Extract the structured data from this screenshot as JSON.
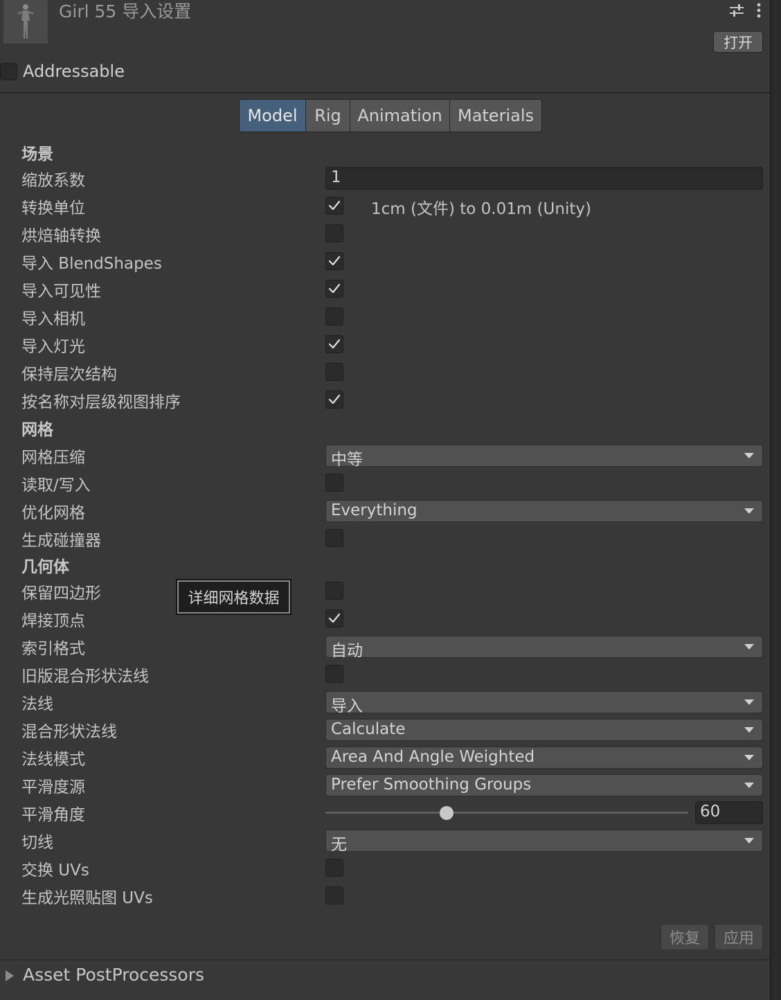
{
  "header": {
    "title": "Girl 55 导入设置",
    "thumbnail_icon": "character-model-icon",
    "open_button": "打开",
    "addressable_label": "Addressable",
    "addressable_checked": false
  },
  "tabs": [
    {
      "label": "Model",
      "active": true
    },
    {
      "label": "Rig",
      "active": false
    },
    {
      "label": "Animation",
      "active": false
    },
    {
      "label": "Materials",
      "active": false
    }
  ],
  "sections": {
    "scene": "场景",
    "meshes": "网格",
    "geometry": "几何体"
  },
  "rows": [
    {
      "label": "缩放系数",
      "type": "text",
      "value": "1"
    },
    {
      "label": "转换单位",
      "type": "checkbox",
      "checked": true,
      "note": "1cm (文件) to 0.01m (Unity)"
    },
    {
      "label": "烘焙轴转换",
      "type": "checkbox",
      "checked": false
    },
    {
      "label": "导入 BlendShapes",
      "type": "checkbox",
      "checked": true
    },
    {
      "label": "导入可见性",
      "type": "checkbox",
      "checked": true
    },
    {
      "label": "导入相机",
      "type": "checkbox",
      "checked": false
    },
    {
      "label": "导入灯光",
      "type": "checkbox",
      "checked": true
    },
    {
      "label": "保持层次结构",
      "type": "checkbox",
      "checked": false
    },
    {
      "label": "按名称对层级视图排序",
      "type": "checkbox",
      "checked": true
    },
    {
      "label": "网格压缩",
      "type": "dropdown",
      "value": "中等"
    },
    {
      "label": "读取/写入",
      "type": "checkbox",
      "checked": false
    },
    {
      "label": "优化网格",
      "type": "dropdown",
      "value": "Everything"
    },
    {
      "label": "生成碰撞器",
      "type": "checkbox",
      "checked": false
    },
    {
      "label": "保留四边形",
      "type": "checkbox",
      "checked": false
    },
    {
      "label": "焊接顶点",
      "type": "checkbox",
      "checked": true
    },
    {
      "label": "索引格式",
      "type": "dropdown",
      "value": "自动"
    },
    {
      "label": "旧版混合形状法线",
      "type": "checkbox",
      "checked": false
    },
    {
      "label": "法线",
      "type": "dropdown",
      "value": "导入"
    },
    {
      "label": "混合形状法线",
      "type": "dropdown",
      "value": "Calculate"
    },
    {
      "label": "法线模式",
      "type": "dropdown",
      "value": "Area And Angle Weighted"
    },
    {
      "label": "平滑度源",
      "type": "dropdown",
      "value": "Prefer Smoothing Groups"
    },
    {
      "label": "平滑角度",
      "type": "slider",
      "value": "60",
      "min": 0,
      "max": 180
    },
    {
      "label": "切线",
      "type": "dropdown",
      "value": "无"
    },
    {
      "label": "交换 UVs",
      "type": "checkbox",
      "checked": false
    },
    {
      "label": "生成光照贴图 UVs",
      "type": "checkbox",
      "checked": false
    }
  ],
  "tooltip": "详细网格数据",
  "footer": {
    "revert_button": "恢复",
    "apply_button": "应用",
    "postprocessors_label": "Asset PostProcessors"
  },
  "colors": {
    "background": "#383838",
    "active_tab": "#46607c",
    "checkbox_bg": "#2b2b2b"
  }
}
